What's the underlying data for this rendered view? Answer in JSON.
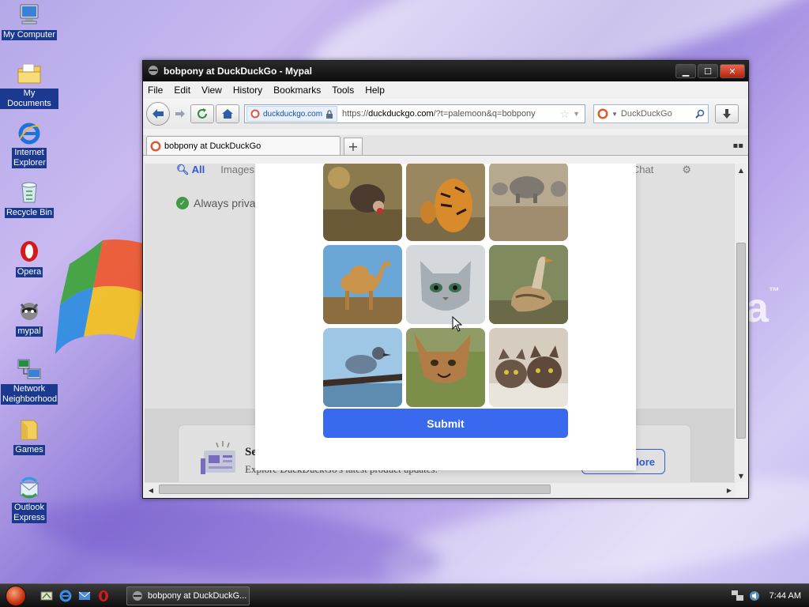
{
  "desktop": {
    "icons": [
      {
        "label": "My Computer"
      },
      {
        "label": "My Documents"
      },
      {
        "label": "Internet Explorer"
      },
      {
        "label": "Recycle Bin"
      },
      {
        "label": "Opera"
      },
      {
        "label": "mypal"
      },
      {
        "label": "Network Neighborhood"
      },
      {
        "label": "Games"
      },
      {
        "label": "Outlook Express"
      }
    ],
    "brand_tm": "™"
  },
  "window": {
    "title": "bobpony at DuckDuckGo - Mypal",
    "controls": {
      "minimize": "▁",
      "maximize": "☐",
      "close": "✕"
    },
    "menu": [
      "File",
      "Edit",
      "View",
      "History",
      "Bookmarks",
      "Tools",
      "Help"
    ],
    "url_identity": "duckduckgo.com",
    "url_prefix": "https://",
    "url_domain": "duckduckgo.com",
    "url_rest": "/?t=palemoon&q=bobpony",
    "search_engine": "DuckDuckGo",
    "tab_title": "bobpony at DuckDuckGo",
    "new_tab": "+"
  },
  "page": {
    "tabs": [
      "All",
      "Images"
    ],
    "right_links": [
      "Chat"
    ],
    "always_private": "Always priva",
    "news_title": "Se",
    "news_desc": "Explore DuckDuckGo's latest product updates.",
    "news_button": "lore"
  },
  "captcha": {
    "tiles": [
      "hedgehog",
      "tiger",
      "rhino",
      "camel",
      "cat",
      "duck",
      "duck-on-branch",
      "caracal",
      "cats"
    ],
    "submit": "Submit"
  },
  "taskbar": {
    "task_label": "bobpony at DuckDuckG...",
    "clock": "7:44 AM"
  },
  "colors": {
    "accent": "#3969ef",
    "title_bg": "#0d0d0d"
  }
}
